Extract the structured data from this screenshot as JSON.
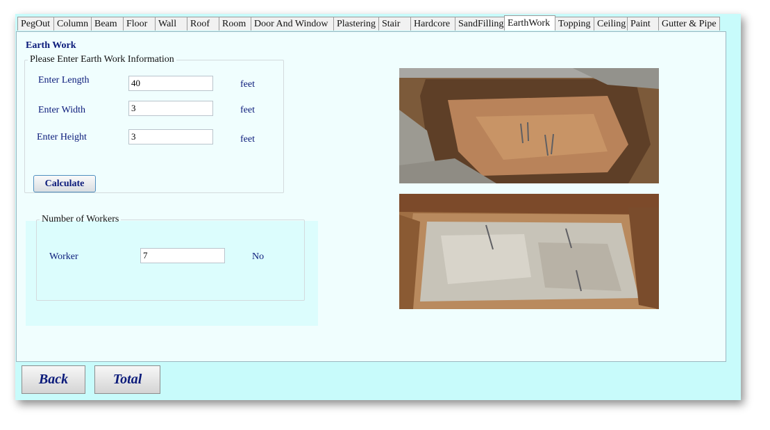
{
  "tabs": [
    {
      "label": "PegOut",
      "active": false
    },
    {
      "label": "Column",
      "active": false
    },
    {
      "label": "Beam",
      "active": false
    },
    {
      "label": "Floor",
      "active": false
    },
    {
      "label": "Wall",
      "active": false
    },
    {
      "label": "Roof",
      "active": false
    },
    {
      "label": "Room",
      "active": false
    },
    {
      "label": "Door And Window",
      "active": false
    },
    {
      "label": "Plastering",
      "active": false
    },
    {
      "label": "Stair",
      "active": false
    },
    {
      "label": "Hardcore",
      "active": false
    },
    {
      "label": "SandFilling",
      "active": false
    },
    {
      "label": "EarthWork",
      "active": true
    },
    {
      "label": "Topping",
      "active": false
    },
    {
      "label": "Ceiling",
      "active": false
    },
    {
      "label": "Paint",
      "active": false
    },
    {
      "label": "Gutter & Pipe",
      "active": false
    }
  ],
  "page": {
    "title": "Earth Work"
  },
  "earthwork_form": {
    "legend": "Please Enter Earth Work Information",
    "length": {
      "label": "Enter Length",
      "value": "40",
      "unit": "feet"
    },
    "width": {
      "label": "Enter Width",
      "value": "3",
      "unit": "feet"
    },
    "height": {
      "label": "Enter Height",
      "value": "3",
      "unit": "feet"
    },
    "calculate_label": "Calculate"
  },
  "workers": {
    "legend": "Number of Workers",
    "label": "Worker",
    "value": "7",
    "unit": "No"
  },
  "footer": {
    "back_label": "Back",
    "total_label": "Total"
  },
  "colors": {
    "window_bg": "#c8fbfb",
    "panel_bg": "#f0fefe",
    "label_text": "#0a1a7a",
    "button_border": "#4f8fbf"
  }
}
